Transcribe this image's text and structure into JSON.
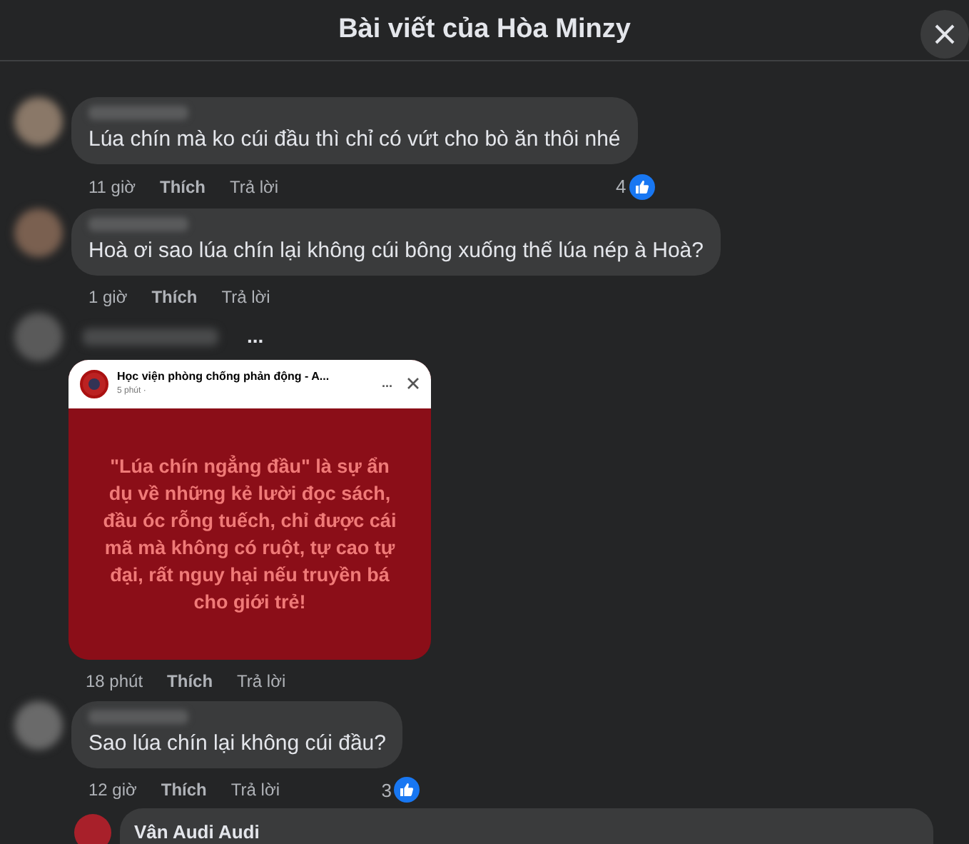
{
  "window": {
    "title": "Bài viết của Hòa Minzy"
  },
  "comments": [
    {
      "kind": "text",
      "text": "Lúa chín mà ko cúi đầu thì chỉ có vứt cho bò ăn thôi nhé",
      "time": "11 giờ",
      "like": "Thích",
      "reply": "Trả lời",
      "reactions": "4"
    },
    {
      "kind": "text",
      "text": "Hoà ơi sao lúa chín lại không cúi bông xuống thế lúa nép à Hoà?",
      "time": "1 giờ",
      "like": "Thích",
      "reply": "Trả lời"
    },
    {
      "kind": "image",
      "more": "...",
      "card": {
        "page": "Học viện phòng chống phản động - A...",
        "posted": "5 phút ·",
        "more": "...",
        "body": "\"Lúa chín ngẳng đầu\" là sự ẩn dụ về những kẻ lười đọc sách, đầu óc rỗng tuếch, chỉ được cái mã mà không có ruột, tự cao tự đại, rất nguy hại nếu truyền bá cho giới trẻ!"
      },
      "time": "18 phút",
      "like": "Thích",
      "reply": "Trả lời"
    },
    {
      "kind": "text",
      "text": "Sao lúa chín lại không cúi đầu?",
      "time": "12 giờ",
      "like": "Thích",
      "reply": "Trả lời",
      "reactions": "3"
    }
  ],
  "reply": {
    "author": "Vân Audi Audi"
  }
}
